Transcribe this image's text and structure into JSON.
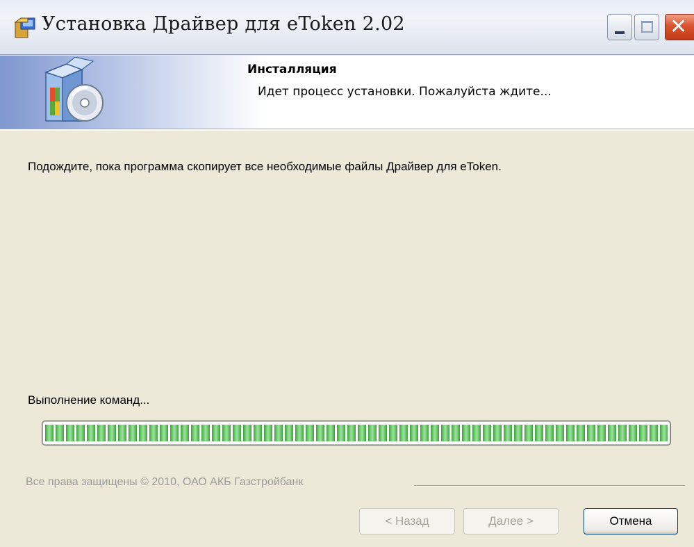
{
  "window": {
    "title": "Установка Драйвер для eToken 2.02",
    "close_glyph": "✕",
    "title_icon": "installer-box-icon"
  },
  "banner": {
    "title": "Инсталляция",
    "subtitle": "Идет процесс установки. Пожалуйста ждите...",
    "icon": "software-box-cd-icon"
  },
  "content": {
    "message": "Подождите, пока программа скопирует все необходимые файлы Драйвер для eToken.",
    "status": "Выполнение команд...",
    "progress_percent": 100
  },
  "footer": {
    "copyright": "Все права защищены © 2010, ОАО АКБ Газстройбанк",
    "back_label": "< Назад",
    "next_label": "Далее >",
    "cancel_label": "Отмена"
  },
  "colors": {
    "progress_green": "#6CC86C",
    "window_bg": "#ECE9D8",
    "close_red": "#D9542F"
  }
}
